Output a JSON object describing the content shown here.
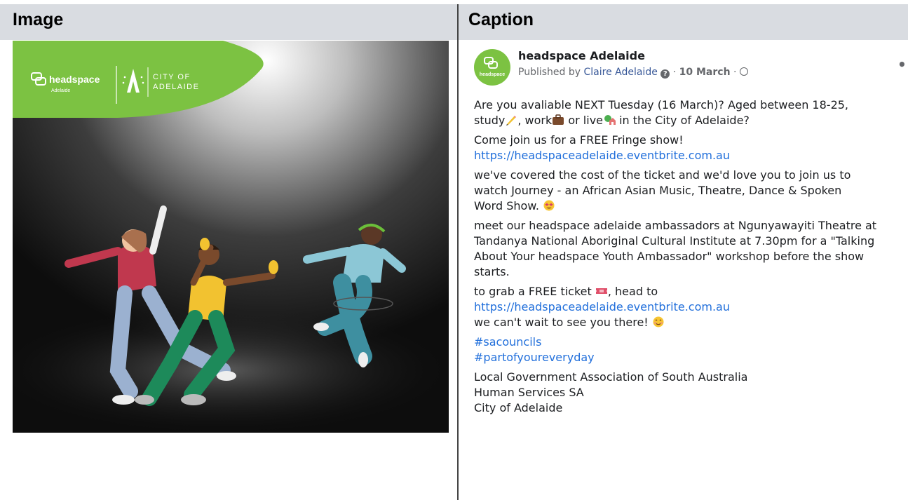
{
  "columns": {
    "image_header": "Image",
    "caption_header": "Caption"
  },
  "graphic": {
    "headspace_logo": "headspace",
    "headspace_sub": "Adelaide",
    "city_logo_line1": "CITY OF",
    "city_logo_line2": "ADELAIDE",
    "brand_green": "#7cc242"
  },
  "post": {
    "page_name": "headspace Adelaide",
    "published_by_prefix": "Published by ",
    "author": "Claire Adelaide",
    "date_sep": " · ",
    "date": "10 March",
    "date_sep2": " · ",
    "more_icon": "•••",
    "p1_l1": "Are you avaliable NEXT Tuesday (16 March)? Aged between 18-25,",
    "p1_l2a": "study",
    "p1_l2b": ", work",
    "p1_l2c": " or live",
    "p1_l2d": " in the City of Adelaide?",
    "p2_l1": "Come join us for a FREE Fringe show!",
    "p2_url": "https://headspaceadelaide.eventbrite.com.au",
    "p3_l1": "we've covered the cost of the ticket and we'd love you to join us to",
    "p3_l2": "watch Journey -  an African Asian Music, Theatre, Dance & Spoken",
    "p3_l3": "Word Show. ",
    "p4_l1": "meet our headspace adelaide ambassadors at Ngunyawayiti Theatre at",
    "p4_l2": "Tandanya National Aboriginal Cultural Institute at 7.30pm for a \"Talking",
    "p4_l3": "About Your headspace Youth Ambassador\" workshop before the show",
    "p4_l4": "starts.",
    "p5_l1a": "to grab a FREE ticket ",
    "p5_l1b": ", head to",
    "p5_url": "https://headspaceadelaide.eventbrite.com.au",
    "p5_l3": "we can't wait to see you there! ",
    "tag1": "#sacouncils",
    "tag2": "#partofyoureveryday",
    "mention1": "Local Government Association of South Australia",
    "mention2": "Human Services SA",
    "mention3": "City of Adelaide"
  }
}
